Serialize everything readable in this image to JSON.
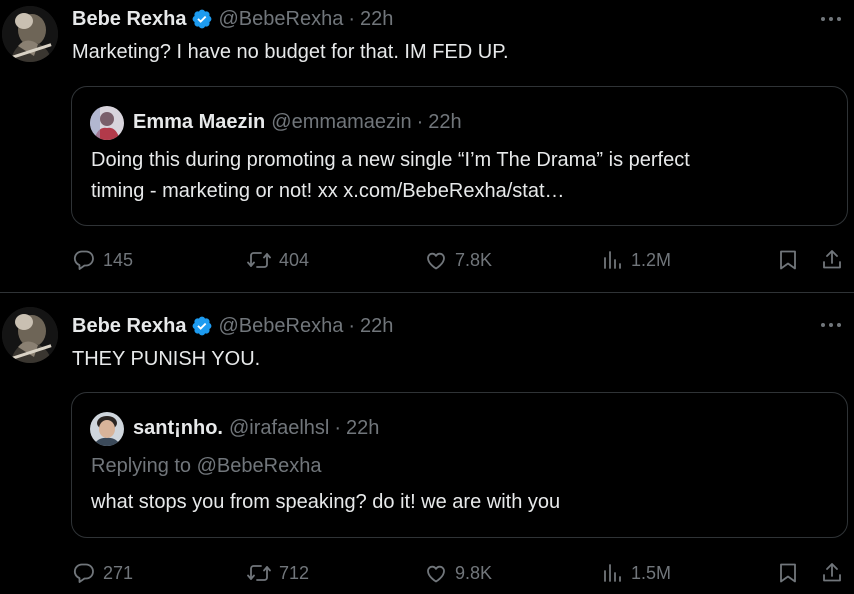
{
  "tweets": [
    {
      "author": {
        "name": "Bebe Rexha",
        "handle": "@BebeRexha",
        "time": "22h",
        "verified": true
      },
      "text": "Marketing? I have no budget for that. IM FED UP.",
      "quote": {
        "name": "Emma Maezin",
        "handle": "@emmamaezin",
        "time": "22h",
        "replying_to": "",
        "lines": [
          "Doing this during promoting a new single “I’m The Drama” is perfect",
          "timing - marketing or not! xx x.com/BebeRexha/stat…"
        ]
      },
      "stats": {
        "replies": "145",
        "reposts": "404",
        "likes": "7.8K",
        "views": "1.2M"
      }
    },
    {
      "author": {
        "name": "Bebe Rexha",
        "handle": "@BebeRexha",
        "time": "22h",
        "verified": true
      },
      "text": "THEY PUNISH YOU.",
      "quote": {
        "name": "sant¡nho.",
        "handle": "@irafaelhsl",
        "time": "22h",
        "replying_to": "Replying to @BebeRexha",
        "lines": [
          "what stops you from speaking? do it! we are with you"
        ]
      },
      "stats": {
        "replies": "271",
        "reposts": "712",
        "likes": "9.8K",
        "views": "1.5M"
      }
    }
  ],
  "separator": "·",
  "icons": {
    "verified": "verified-badge-icon",
    "more": "more-dots-icon",
    "reply": "reply-bubble-icon",
    "repost": "repost-arrows-icon",
    "like": "heart-icon",
    "views": "views-bars-icon",
    "bookmark": "bookmark-icon",
    "share": "share-upload-icon"
  },
  "colors": {
    "background": "#000000",
    "text": "#e7e9ea",
    "muted": "#71767b",
    "border": "#2f3336",
    "verified": "#1d9bf0"
  }
}
